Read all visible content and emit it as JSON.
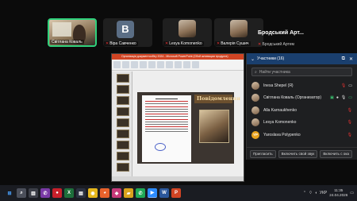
{
  "tiles": [
    {
      "name": "Світлана Коваль",
      "active": true
    },
    {
      "name": "Віра Савченко",
      "letter": "В"
    },
    {
      "name": "Lesya Komonenko"
    },
    {
      "name": "Валерія Сушич"
    },
    {
      "name": "Бродський Артем"
    }
  ],
  "presenter_big": "Бродський Арт...",
  "shared_window_title": "Організація документообігу 2024 - Microsoft PowerPoint (Сбой активации продукта)",
  "slide_heading": "Повідомлення",
  "panel": {
    "title": "Участники (16)",
    "search_placeholder": "Найти участника",
    "participants": [
      {
        "name": "Inesa Shepel (Я)"
      },
      {
        "name": "Світлана Коваль (Организатор)"
      },
      {
        "name": "Alla Karnaukhenko"
      },
      {
        "name": "Lesya Komonenko"
      },
      {
        "name": "Yaroslava Polypenko",
        "initials": "YP"
      }
    ],
    "buttons": [
      "Пригласить",
      "Включить свой звук",
      "Включить с ока"
    ]
  },
  "taskbar": {
    "lang": "УКР",
    "time": "11:35",
    "date": "24.04.2026"
  },
  "colors": {
    "active_border": "#2fd07b",
    "panel_header": "#1a3f6e",
    "ppt_title": "#d04423"
  }
}
